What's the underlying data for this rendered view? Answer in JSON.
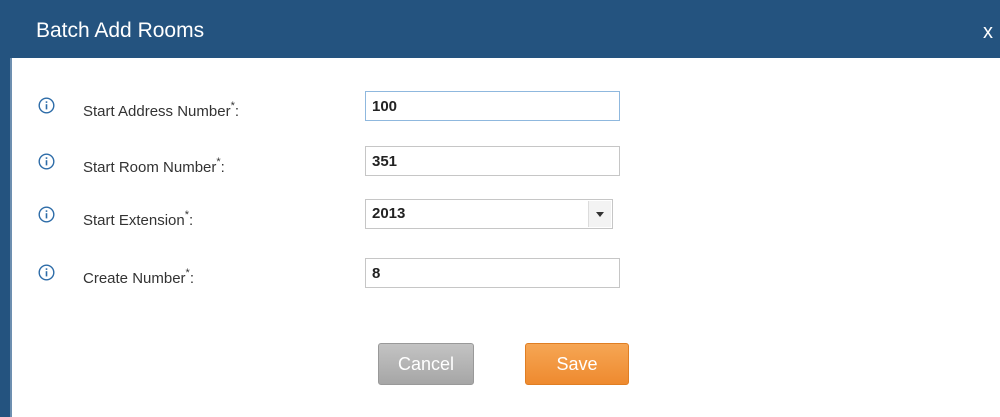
{
  "dialog": {
    "title": "Batch Add Rooms",
    "close_label": "x"
  },
  "form": {
    "fields": [
      {
        "label": "Start Address Number",
        "required_mark": "*",
        "suffix": ":",
        "value": "100",
        "type": "text",
        "icon": "info-icon"
      },
      {
        "label": "Start Room Number",
        "required_mark": "*",
        "suffix": ":",
        "value": "351",
        "type": "text",
        "icon": "info-icon"
      },
      {
        "label": "Start Extension",
        "required_mark": "*",
        "suffix": ":",
        "value": "2013",
        "type": "select",
        "icon": "info-icon"
      },
      {
        "label": "Create Number",
        "required_mark": "*",
        "suffix": ":",
        "value": "8",
        "type": "text",
        "icon": "info-icon"
      }
    ]
  },
  "buttons": {
    "cancel_label": "Cancel",
    "save_label": "Save"
  },
  "colors": {
    "titlebar": "#24537f",
    "save_button": "#ee8a2f",
    "cancel_button": "#a6a6a6"
  }
}
